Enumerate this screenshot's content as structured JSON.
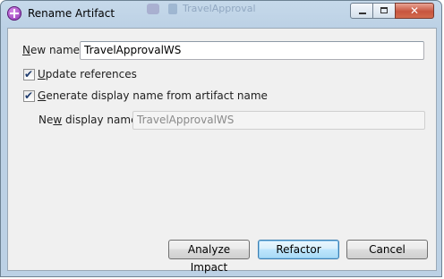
{
  "window": {
    "title": "Rename Artifact",
    "background_title": "TravelApproval",
    "controls": {
      "close": "✕"
    }
  },
  "form": {
    "new_name": {
      "label_underlined": "N",
      "label_rest": "ew name:",
      "value": "TravelApprovalWS"
    },
    "update_references": {
      "label_underlined": "U",
      "label_rest": "pdate references",
      "checked": true,
      "check": "✔"
    },
    "generate_display_name": {
      "label_underlined": "G",
      "label_rest": "enerate display name from artifact name",
      "checked": true,
      "check": "✔"
    },
    "new_display_name": {
      "label_prefix": "Ne",
      "label_underlined": "w",
      "label_rest": " display name:",
      "value": "TravelApprovalWS",
      "disabled": true
    }
  },
  "buttons": {
    "analyze_prefix": "",
    "analyze_underlined": "A",
    "analyze_rest": "nalyze Impact",
    "refactor": "Refactor",
    "cancel": "Cancel"
  },
  "colors": {
    "accent": "#3c7fb1",
    "frame": "#bcd1e5"
  }
}
